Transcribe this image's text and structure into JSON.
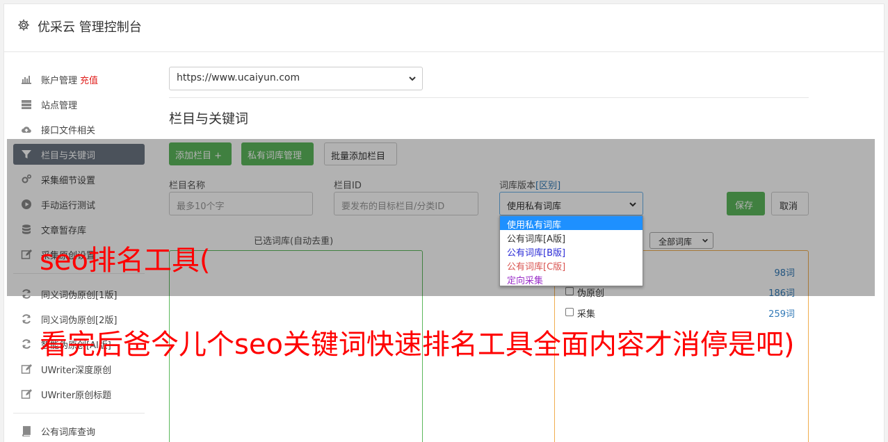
{
  "header": {
    "title": "优采云 管理控制台"
  },
  "sidebar": {
    "items": [
      {
        "label": "账户管理",
        "extra": "充值",
        "icon": "bar-chart-icon"
      },
      {
        "label": "站点管理",
        "icon": "server-icon"
      },
      {
        "label": "接口文件相关",
        "icon": "cloud-upload-icon"
      },
      {
        "label": "栏目与关键词",
        "icon": "filter-icon",
        "active": true
      },
      {
        "label": "采集细节设置",
        "icon": "gears-icon"
      },
      {
        "label": "手动运行测试",
        "icon": "play-circle-icon"
      },
      {
        "label": "文章暂存库",
        "icon": "database-icon"
      },
      {
        "label": "采集原创设置",
        "icon": "edit-icon"
      },
      {
        "label": "同义词伪原创[1版]",
        "icon": "refresh-icon"
      },
      {
        "label": "同义词伪原创[2版]",
        "icon": "refresh-icon"
      },
      {
        "label": "智能伪原创[AI版]",
        "icon": "refresh-icon"
      },
      {
        "label": "UWriter深度原创",
        "icon": "edit-icon"
      },
      {
        "label": "UWriter原创标题",
        "icon": "edit-icon"
      },
      {
        "label": "公有词库查询",
        "icon": "book-icon"
      }
    ]
  },
  "main": {
    "site_select": "https://www.ucaiyun.com",
    "section_title": "栏目与关键词",
    "buttons": {
      "add_column": "添加栏目 +",
      "private_lib": "私有词库管理",
      "batch_add": "批量添加栏目"
    },
    "form": {
      "column_name_label": "栏目名称",
      "column_name_placeholder": "最多10个字",
      "column_id_label": "栏目ID",
      "column_id_placeholder": "要发布的目标栏目/分类ID",
      "lib_version_label": "词库版本",
      "lib_version_link": "[区别]",
      "lib_version_value": "使用私有词库",
      "save": "保存",
      "cancel": "取消"
    },
    "dropdown": {
      "options": [
        {
          "label": "使用私有词库",
          "color": "#ffffff"
        },
        {
          "label": "公有词库[A版]",
          "color": "#333333"
        },
        {
          "label": "公有词库[B版]",
          "color": "#2a2ad6"
        },
        {
          "label": "公有词库[C版]",
          "color": "#d9534f"
        },
        {
          "label": "定向采集",
          "color": "#9b30c9"
        }
      ]
    },
    "selected_list_label": "已选词库(自动去重)",
    "filter_select": "全部词库",
    "libraries": [
      {
        "name": "",
        "count": "98词"
      },
      {
        "name": "伪原创",
        "count": "186词"
      },
      {
        "name": "采集",
        "count": "259词"
      }
    ]
  },
  "overlay_text": {
    "line1": "seo排名工具(",
    "line2": "看完后爸今儿个seo关键词快速排名工具全面内容才消停是吧)"
  },
  "colors": {
    "primary_green": "#5cb85c",
    "active_nav": "#6c7683",
    "accent_red": "#e0201d",
    "link_blue": "#337ab7"
  }
}
